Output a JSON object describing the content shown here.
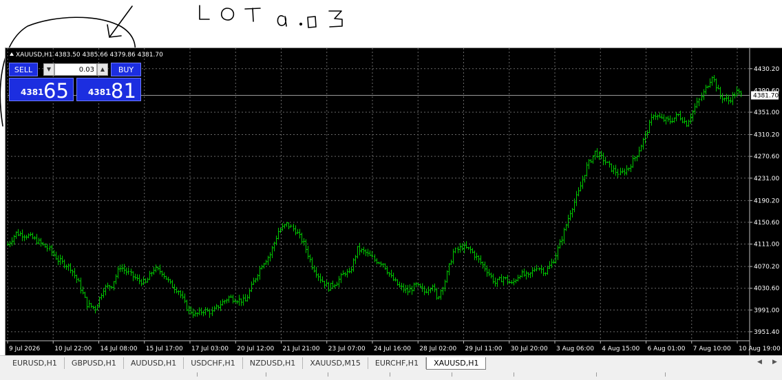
{
  "annotation": {
    "text": "LOTa.03"
  },
  "symbol_info": {
    "symbol": "XAUUSD,H1",
    "ohlc": "4383.50 4385.66 4379.86 4381.70"
  },
  "trade_panel": {
    "sell_label": "SELL",
    "buy_label": "BUY",
    "lot_value": "0.03",
    "sell_price_small": "4381",
    "sell_price_big": "65",
    "buy_price_small": "4381",
    "buy_price_big": "81",
    "spin_down_icon": "triangle-down-icon",
    "spin_up_icon": "triangle-up-icon"
  },
  "tabs": [
    {
      "label": "EURUSD,H1"
    },
    {
      "label": "GBPUSD,H1"
    },
    {
      "label": "AUDUSD,H1"
    },
    {
      "label": "USDCHF,H1"
    },
    {
      "label": "NZDUSD,H1"
    },
    {
      "label": "XAUUSD,M15"
    },
    {
      "label": "EURCHF,H1"
    },
    {
      "label": "XAUUSD,H1",
      "active": true
    }
  ],
  "colors": {
    "background": "#000000",
    "bars": "#00c800",
    "grid": "#6a6a6a",
    "price_panel": "#1c2ee0"
  },
  "chart_data": {
    "type": "line",
    "style": "ohlc-bars",
    "symbol": "XAUUSD",
    "timeframe": "H1",
    "grid": true,
    "current_price": 4381.7,
    "current_price_label": "4381.70",
    "partial_price_label": "4390.60",
    "ylim": [
      3940,
      4455
    ],
    "y_ticks": [
      {
        "label": "4430.20",
        "value": 4430.2
      },
      {
        "label": "4351.00",
        "value": 4351.0
      },
      {
        "label": "4310.20",
        "value": 4310.2
      },
      {
        "label": "4270.60",
        "value": 4270.6
      },
      {
        "label": "4231.00",
        "value": 4231.0
      },
      {
        "label": "4190.20",
        "value": 4190.2
      },
      {
        "label": "4150.60",
        "value": 4150.6
      },
      {
        "label": "4111.00",
        "value": 4111.0
      },
      {
        "label": "4070.20",
        "value": 4070.2
      },
      {
        "label": "4030.60",
        "value": 4030.6
      },
      {
        "label": "3991.00",
        "value": 3991.0
      },
      {
        "label": "3951.40",
        "value": 3951.4
      }
    ],
    "x_labels": [
      "9 Jul 2026",
      "10 Jul 22:00",
      "14 Jul 08:00",
      "15 Jul 17:00",
      "17 Jul 03:00",
      "20 Jul 12:00",
      "21 Jul 21:00",
      "23 Jul 07:00",
      "24 Jul 16:00",
      "28 Jul 02:00",
      "29 Jul 11:00",
      "30 Jul 20:00",
      "3 Aug 06:00",
      "4 Aug 15:00",
      "6 Aug 01:00",
      "7 Aug 10:00",
      "10 Aug 19:00"
    ],
    "keypoints": [
      [
        0,
        4110
      ],
      [
        4,
        4131
      ],
      [
        10,
        4126
      ],
      [
        14,
        4117
      ],
      [
        20,
        4101
      ],
      [
        24,
        4082
      ],
      [
        30,
        4068
      ],
      [
        34,
        4040
      ],
      [
        38,
        4001
      ],
      [
        42,
        3994
      ],
      [
        46,
        4030
      ],
      [
        50,
        4036
      ],
      [
        54,
        4070
      ],
      [
        58,
        4058
      ],
      [
        62,
        4046
      ],
      [
        66,
        4040
      ],
      [
        70,
        4066
      ],
      [
        74,
        4060
      ],
      [
        78,
        4038
      ],
      [
        82,
        4026
      ],
      [
        86,
        3995
      ],
      [
        90,
        3982
      ],
      [
        94,
        3990
      ],
      [
        98,
        3987
      ],
      [
        102,
        4002
      ],
      [
        106,
        4014
      ],
      [
        110,
        4010
      ],
      [
        114,
        4007
      ],
      [
        118,
        4042
      ],
      [
        122,
        4074
      ],
      [
        126,
        4092
      ],
      [
        130,
        4134
      ],
      [
        134,
        4147
      ],
      [
        138,
        4136
      ],
      [
        142,
        4112
      ],
      [
        146,
        4072
      ],
      [
        150,
        4048
      ],
      [
        154,
        4032
      ],
      [
        158,
        4042
      ],
      [
        162,
        4060
      ],
      [
        164,
        4056
      ],
      [
        168,
        4102
      ],
      [
        172,
        4095
      ],
      [
        176,
        4082
      ],
      [
        180,
        4076
      ],
      [
        184,
        4050
      ],
      [
        188,
        4033
      ],
      [
        192,
        4025
      ],
      [
        196,
        4036
      ],
      [
        200,
        4024
      ],
      [
        204,
        4038
      ],
      [
        206,
        4010
      ],
      [
        210,
        4044
      ],
      [
        214,
        4096
      ],
      [
        218,
        4106
      ],
      [
        222,
        4100
      ],
      [
        226,
        4082
      ],
      [
        230,
        4063
      ],
      [
        234,
        4040
      ],
      [
        238,
        4050
      ],
      [
        242,
        4038
      ],
      [
        246,
        4057
      ],
      [
        250,
        4052
      ],
      [
        254,
        4070
      ],
      [
        258,
        4060
      ],
      [
        262,
        4082
      ],
      [
        266,
        4122
      ],
      [
        270,
        4170
      ],
      [
        274,
        4205
      ],
      [
        278,
        4252
      ],
      [
        282,
        4278
      ],
      [
        286,
        4265
      ],
      [
        290,
        4248
      ],
      [
        294,
        4238
      ],
      [
        298,
        4250
      ],
      [
        302,
        4275
      ],
      [
        306,
        4308
      ],
      [
        310,
        4348
      ],
      [
        314,
        4338
      ],
      [
        318,
        4335
      ],
      [
        322,
        4346
      ],
      [
        326,
        4330
      ],
      [
        330,
        4360
      ],
      [
        334,
        4386
      ],
      [
        338,
        4418
      ],
      [
        342,
        4380
      ],
      [
        346,
        4372
      ],
      [
        350,
        4388
      ],
      [
        352,
        4382
      ]
    ]
  }
}
